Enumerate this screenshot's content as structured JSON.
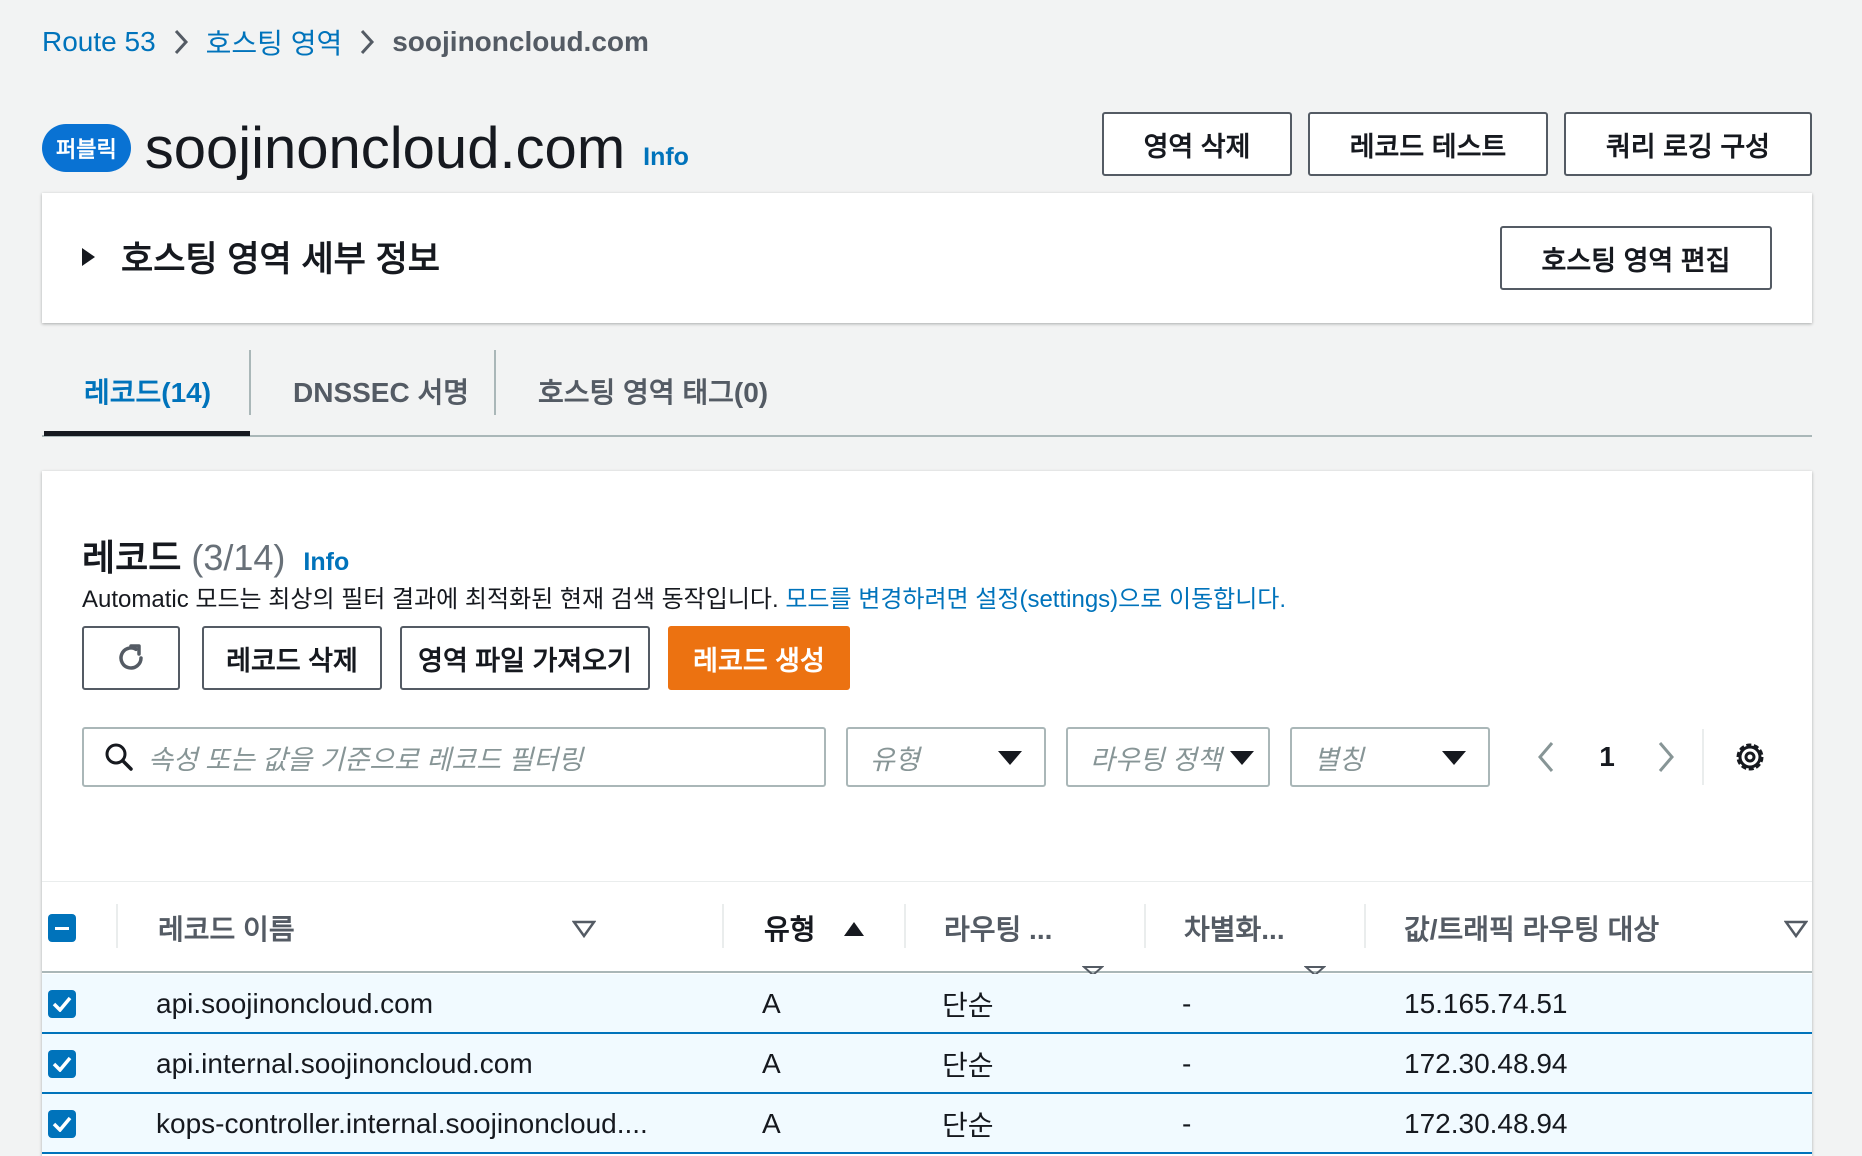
{
  "breadcrumb": {
    "items": [
      "Route 53",
      "호스팅 영역"
    ],
    "current": "soojinoncloud.com"
  },
  "header": {
    "badge": "퍼블릭",
    "title": "soojinoncloud.com",
    "info": "Info",
    "buttons": {
      "delete_zone": "영역 삭제",
      "test_record": "레코드 테스트",
      "query_logging": "쿼리 로깅 구성"
    }
  },
  "details": {
    "title": "호스팅 영역 세부 정보",
    "edit_button": "호스팅 영역 편집"
  },
  "tabs": [
    {
      "label": "레코드(14)",
      "active": true
    },
    {
      "label": "DNSSEC 서명",
      "active": false
    },
    {
      "label": "호스팅 영역 태그(0)",
      "active": false
    }
  ],
  "records": {
    "title": "레코드",
    "count": "(3/14)",
    "info": "Info",
    "description": "Automatic 모드는 최상의 필터 결과에 최적화된 현재 검색 동작입니다.",
    "description_link": "모드를 변경하려면 설정(settings)으로 이동합니다.",
    "buttons": {
      "delete": "레코드 삭제",
      "import": "영역 파일 가져오기",
      "create": "레코드 생성"
    },
    "search_placeholder": "속성 또는 값을 기준으로 레코드 필터링",
    "filters": {
      "type": "유형",
      "routing": "라우팅 정책",
      "alias": "별칭"
    },
    "page": "1",
    "columns": {
      "name": "레코드 이름",
      "type": "유형",
      "routing": "라우팅 ...",
      "differentiator": "차별화...",
      "value": "값/트래픽 라우팅 대상"
    },
    "rows": [
      {
        "name": "api.soojinoncloud.com",
        "type": "A",
        "routing": "단순",
        "differentiator": "-",
        "value": "15.165.74.51",
        "checked": true
      },
      {
        "name": "api.internal.soojinoncloud.com",
        "type": "A",
        "routing": "단순",
        "differentiator": "-",
        "value": "172.30.48.94",
        "checked": true
      },
      {
        "name": "kops-controller.internal.soojinoncloud....",
        "type": "A",
        "routing": "단순",
        "differentiator": "-",
        "value": "172.30.48.94",
        "checked": true
      }
    ]
  },
  "colors": {
    "link": "#0073bb",
    "primary": "#ec7211",
    "badge": "#0972d3"
  }
}
